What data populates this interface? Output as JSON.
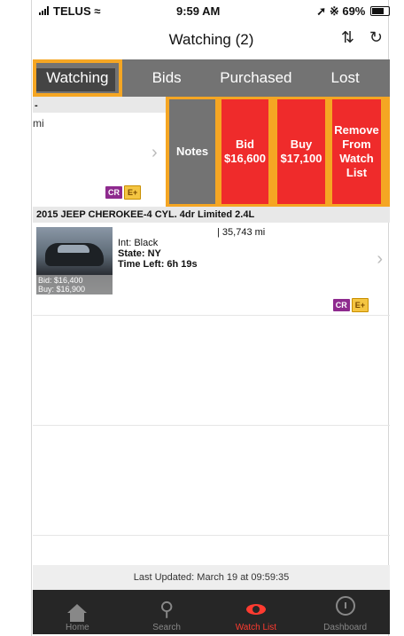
{
  "status_bar": {
    "carrier": "TELUS",
    "time": "9:59 AM",
    "battery": "69%"
  },
  "nav": {
    "title": "Watching (2)"
  },
  "tabs": [
    {
      "label": "Watching",
      "active": true
    },
    {
      "label": "Bids"
    },
    {
      "label": "Purchased"
    },
    {
      "label": "Lost"
    }
  ],
  "row1": {
    "title": "-",
    "mileage_fragment": "mi",
    "badges": [
      "CR",
      "E+"
    ],
    "actions": {
      "notes": "Notes",
      "bid": "Bid\n$16,600",
      "buy": "Buy\n$17,100",
      "remove": "Remove\nFrom\nWatch\nList"
    }
  },
  "row2": {
    "title": "2015 JEEP CHEROKEE-4 CYL. 4dr Limited 2.4L",
    "mileage": "| 35,743 mi",
    "interior": "Int: Black",
    "state": "State: NY",
    "time_left": "Time Left: 6h 19s",
    "bid": "Bid: $16,400",
    "buy": "Buy: $16,900",
    "badges": [
      "CR",
      "E+"
    ]
  },
  "footer": {
    "last_updated": "Last Updated: March 19 at 09:59:35"
  },
  "tab_bar": [
    {
      "label": "Home",
      "icon": "home-icon"
    },
    {
      "label": "Search",
      "icon": "search-icon"
    },
    {
      "label": "Watch List",
      "icon": "eye-icon",
      "active": true
    },
    {
      "label": "Dashboard",
      "icon": "gauge-icon"
    }
  ],
  "colors": {
    "accent_red": "#ef2b2b",
    "highlight_orange": "#f5a623",
    "tab_gray": "#737373"
  }
}
